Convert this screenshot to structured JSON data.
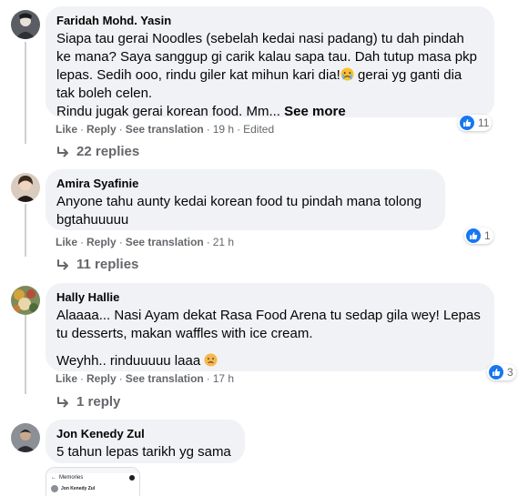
{
  "comments": [
    {
      "author": "Faridah Mohd. Yasin",
      "text_lines": [
        "Siapa tau gerai Noodles (sebelah kedai nasi padang) tu dah pindah",
        "ke mana? Saya sanggup gi carik kalau sapa tau. Dah tutup masa pkp",
        "lepas. Sedih ooo, rindu giler kat mihun kari dia!",
        " gerai yg ganti dia",
        "tak boleh celen.",
        "Rindu jugak gerai korean food. Mm... "
      ],
      "see_more": "See more",
      "like": "Like",
      "reply": "Reply",
      "translate": "See translation",
      "time": "19 h",
      "edited": "Edited",
      "reaction_count": "11",
      "replies": "22 replies"
    },
    {
      "author": "Amira Syafinie",
      "text_lines": [
        "Anyone tahu aunty kedai korean food tu pindah mana tolong",
        "bgtahuuuuu"
      ],
      "like": "Like",
      "reply": "Reply",
      "translate": "See translation",
      "time": "21 h",
      "reaction_count": "1",
      "replies": "11 replies"
    },
    {
      "author": "Hally Hallie",
      "text_lines": [
        "Alaaaa... Nasi Ayam dekat Rasa Food Arena tu sedap gila wey! Lepas",
        "tu desserts, makan waffles with ice cream.",
        "Weyhh.. rinduuuuu laaa "
      ],
      "like": "Like",
      "reply": "Reply",
      "translate": "See translation",
      "time": "17 h",
      "reaction_count": "3",
      "replies": "1 reply"
    },
    {
      "author": "Jon Kenedy Zul",
      "text_lines": [
        "5 tahun lepas tarikh yg sama"
      ]
    }
  ],
  "attachment": {
    "title": "Memories",
    "name": "Jon Kenedy Zul"
  },
  "colors": {
    "bubble": "#f0f2f5",
    "secondary_text": "#65676b",
    "like_blue": "#1877f2",
    "thread_line": "#ccd0d5"
  },
  "icons": [
    "like-icon",
    "reply-arrow-icon",
    "crying-face-emoji",
    "sad-face-emoji",
    "avatar"
  ]
}
